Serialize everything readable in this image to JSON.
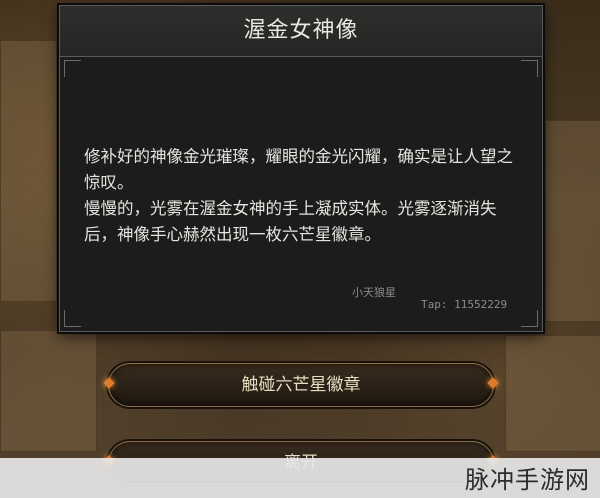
{
  "dialog": {
    "title": "渥金女神像",
    "paragraphs": [
      "修补好的神像金光璀璨，耀眼的金光闪耀，确实是让人望之惊叹。",
      "慢慢的，光雾在渥金女神的手上凝成实体。光雾逐渐消失后，神像手心赫然出现一枚六芒星徽章。"
    ],
    "watermark_name": "小天狼星",
    "watermark_tap": "Tap: 11552229"
  },
  "actions": {
    "touch_label": "触碰六芒星徽章",
    "leave_label": "离开"
  },
  "footer": {
    "site_name": "脉冲手游网"
  },
  "colors": {
    "panel_bg": "#1c1c1c",
    "button_border": "#8b6c43",
    "gem_accent": "#e07b2e"
  }
}
